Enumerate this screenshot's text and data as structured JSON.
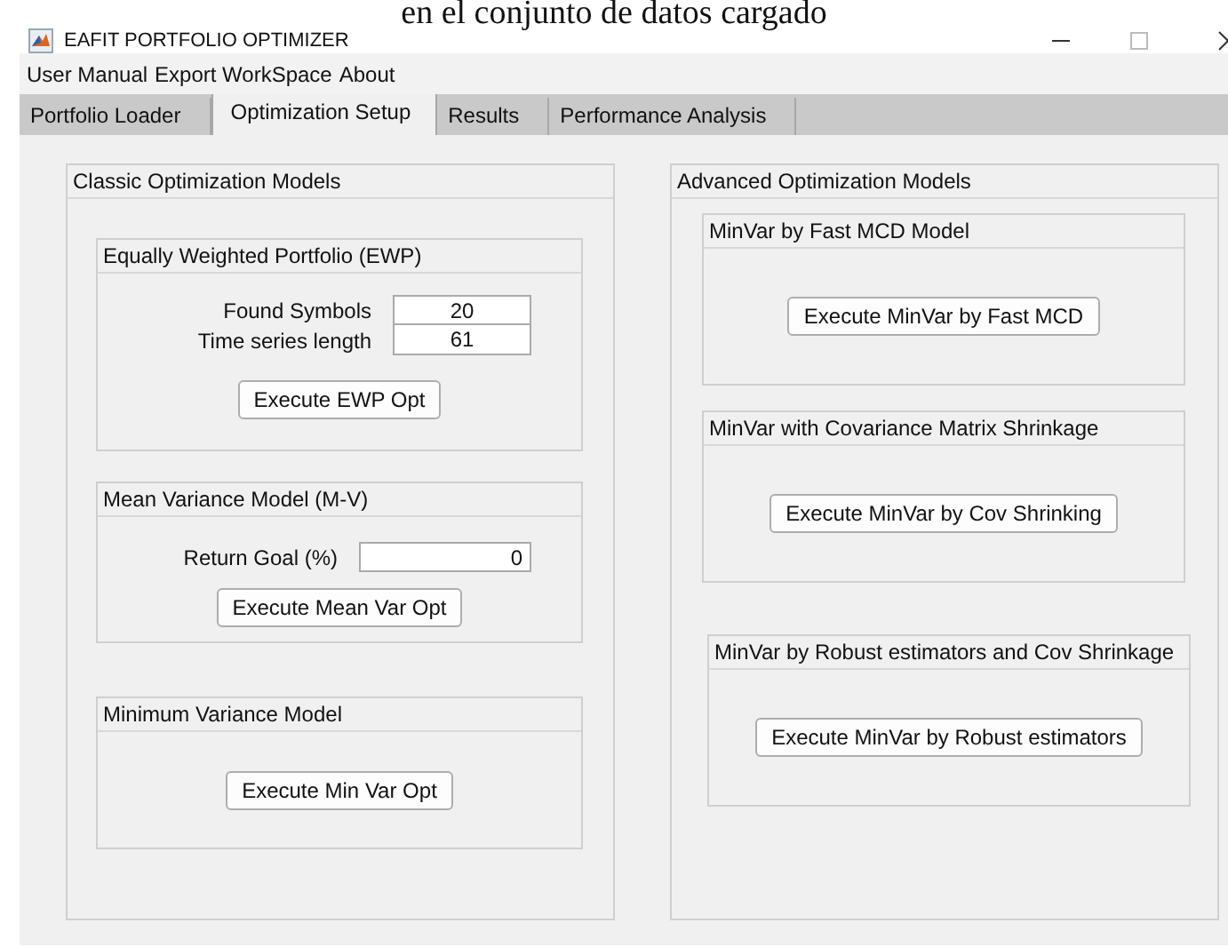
{
  "caption_fragment": "en el conjunto de datos cargado",
  "window": {
    "title": "EAFIT PORTFOLIO OPTIMIZER"
  },
  "menu": [
    "User Manual",
    "Export WorkSpace",
    "About"
  ],
  "tabs": [
    {
      "label": "Portfolio Loader",
      "selected": false
    },
    {
      "label": "Optimization Setup",
      "selected": true
    },
    {
      "label": "Results",
      "selected": false
    },
    {
      "label": "Performance Analysis",
      "selected": false
    }
  ],
  "panels": [
    {
      "title": "Classic Optimization Models",
      "groups": [
        {
          "title": "Equally Weighted Portfolio (EWP)",
          "kind": "fields",
          "fields": [
            {
              "label": "Found Symbols",
              "value": "20"
            },
            {
              "label": "Time series length",
              "value": "61"
            }
          ],
          "button": "Execute EWP Opt"
        },
        {
          "title": "Mean Variance Model (M-V)",
          "kind": "goal",
          "fields": [
            {
              "label": "Return Goal (%)",
              "value": "0"
            }
          ],
          "button": "Execute Mean Var Opt"
        },
        {
          "title": "Minimum Variance Model",
          "kind": "button",
          "button": "Execute Min Var Opt"
        }
      ]
    },
    {
      "title": "Advanced Optimization Models",
      "groups": [
        {
          "title": "MinVar by Fast MCD Model",
          "kind": "button",
          "button": "Execute MinVar by Fast MCD"
        },
        {
          "title": "MinVar with Covariance Matrix Shrinkage",
          "kind": "button",
          "button": "Execute MinVar by Cov Shrinking"
        },
        {
          "title": "MinVar by Robust estimators and Cov Shrinkage",
          "kind": "button",
          "button": "Execute MinVar by Robust estimators"
        }
      ]
    }
  ]
}
